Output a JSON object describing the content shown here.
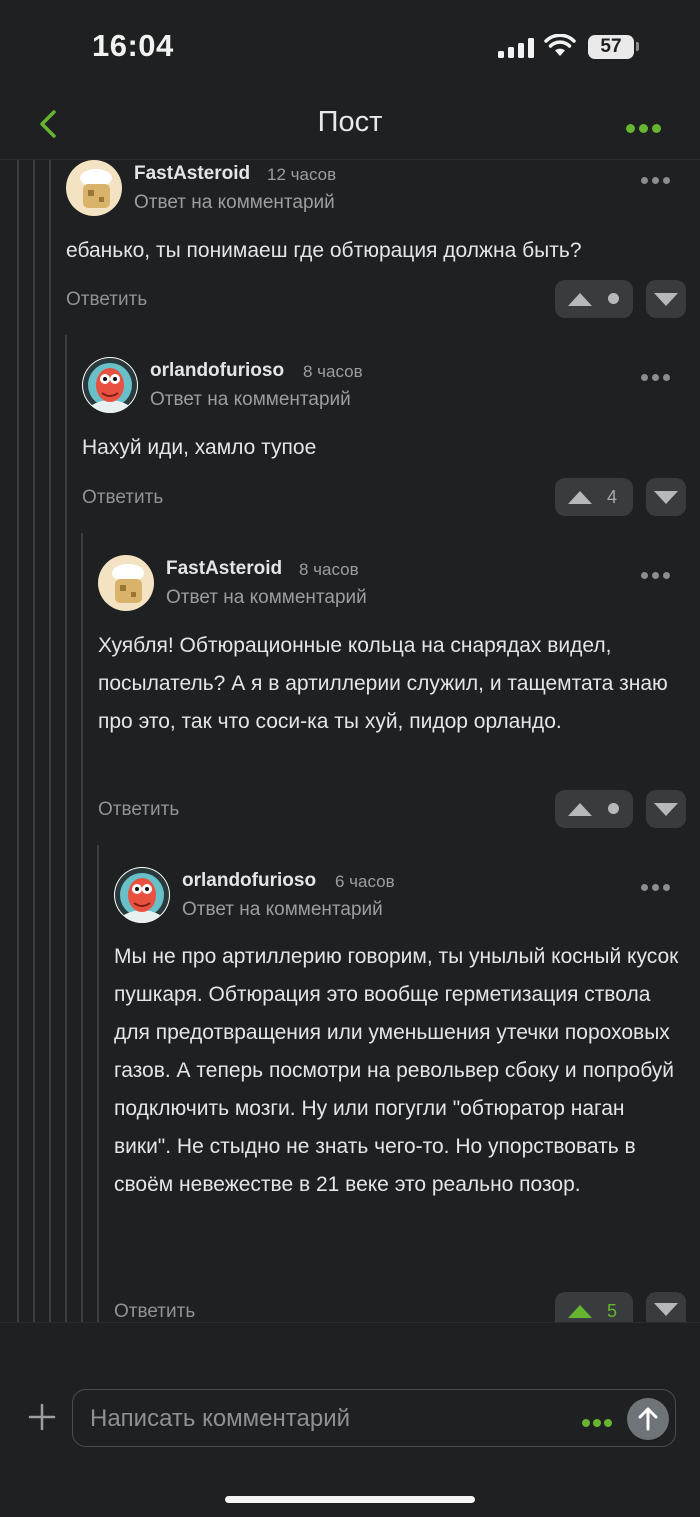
{
  "status_bar": {
    "time": "16:04",
    "battery": "57"
  },
  "header": {
    "title": "Пост"
  },
  "comments": [
    {
      "user": "FastAsteroid",
      "time": "12 часов",
      "reply_to": "Ответ на комментарий",
      "text": "ебанько, ты понимаеш где обтюрация должна быть?",
      "reply": "Ответить",
      "score": ""
    },
    {
      "user": "orlandofurioso",
      "time": "8 часов",
      "reply_to": "Ответ на комментарий",
      "text": "Нахуй иди, хамло тупое",
      "reply": "Ответить",
      "score": "4"
    },
    {
      "user": "FastAsteroid",
      "time": "8 часов",
      "reply_to": "Ответ на комментарий",
      "text": "Хуябля! Обтюрационные кольца на снарядах видел, посылатель? А я в артиллерии служил, и тащемтата знаю про это, так что соси-ка ты хуй, пидор орландо.",
      "reply": "Ответить",
      "score": ""
    },
    {
      "user": "orlandofurioso",
      "time": "6 часов",
      "reply_to": "Ответ на комментарий",
      "text": "Мы не про артиллерию говорим, ты унылый косный кусок пушкаря. Обтюрация это вообще герметизация ствола для предотвращения или уменьшения утечки пороховых газов. А теперь посмотри на револьвер сбоку и попробуй подключить мозги. Ну или погугли \"обтюратор наган вики\". Не стыдно не знать чего-то. Но упорствовать в своём невежестве в 21 веке это реально позор.",
      "reply": "Ответить",
      "score": "5"
    }
  ],
  "composer": {
    "placeholder": "Написать комментарий"
  },
  "colors": {
    "accent": "#66b42f",
    "background": "#1e2021",
    "upvoted": "#66b42f"
  }
}
